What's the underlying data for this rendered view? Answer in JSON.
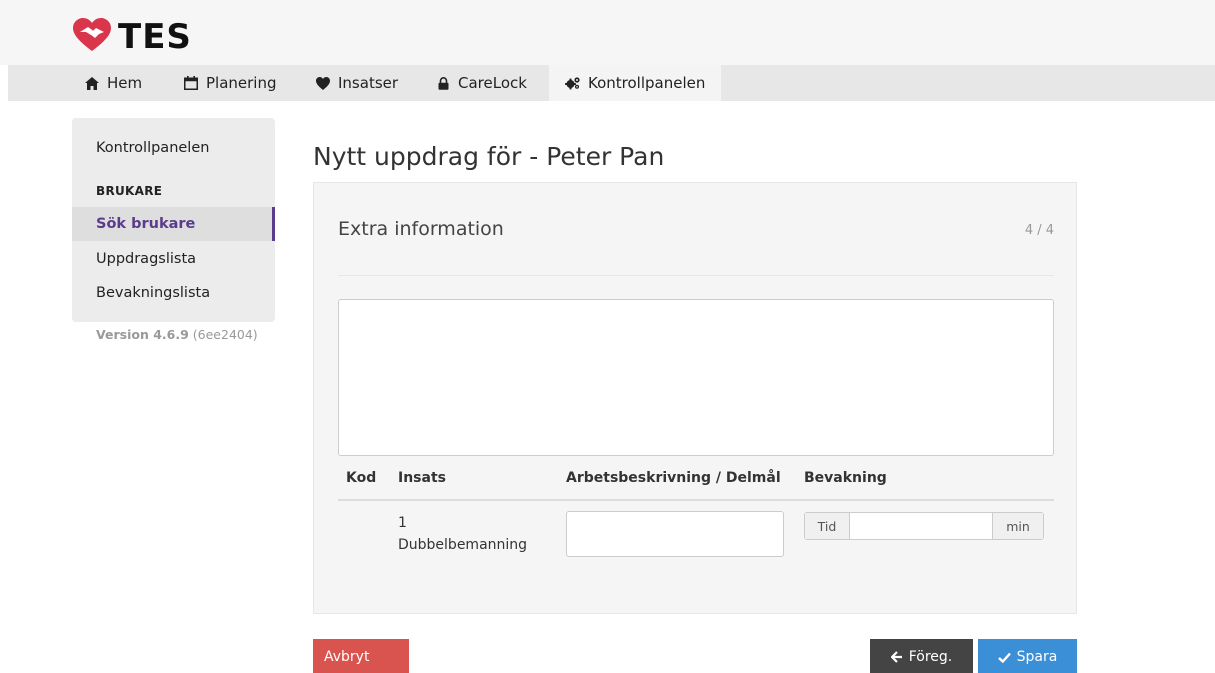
{
  "app": {
    "name": "TES"
  },
  "nav": {
    "items": [
      {
        "label": "Hem",
        "icon": "home-icon"
      },
      {
        "label": "Planering",
        "icon": "calendar-icon"
      },
      {
        "label": "Insatser",
        "icon": "heart-icon"
      },
      {
        "label": "CareLock",
        "icon": "lock-icon"
      },
      {
        "label": "Kontrollpanelen",
        "icon": "cogs-icon",
        "active": true
      }
    ]
  },
  "sidebar": {
    "top_item": "Kontrollpanelen",
    "section_heading": "BRUKARE",
    "items": [
      {
        "label": "Sök brukare",
        "active": true
      },
      {
        "label": "Uppdragslista"
      },
      {
        "label": "Bevakningslista"
      }
    ],
    "version_label": "Version 4.6.9",
    "version_hash": "(6ee2404)"
  },
  "page": {
    "title": "Nytt uppdrag för - Peter Pan"
  },
  "panel": {
    "title": "Extra information",
    "step": "4 / 4",
    "textarea_value": "",
    "table": {
      "headers": [
        "Kod",
        "Insats",
        "Arbetsbeskrivning / Delmål",
        "Bevakning"
      ],
      "rows": [
        {
          "kod": "",
          "insats_number": "1",
          "insats_name": "Dubbelbemanning",
          "arbetsbeskrivning": "",
          "bevakning_prefix": "Tid",
          "bevakning_value": "",
          "bevakning_suffix": "min"
        }
      ]
    }
  },
  "buttons": {
    "cancel": "Avbryt",
    "prev": "Föreg.",
    "save": "Spara"
  },
  "colors": {
    "logo_red": "#d9364c",
    "accent_purple": "#5b3c8c",
    "cancel_red": "#d9534f",
    "save_blue": "#3a8fd6",
    "prev_dark": "#444444"
  }
}
